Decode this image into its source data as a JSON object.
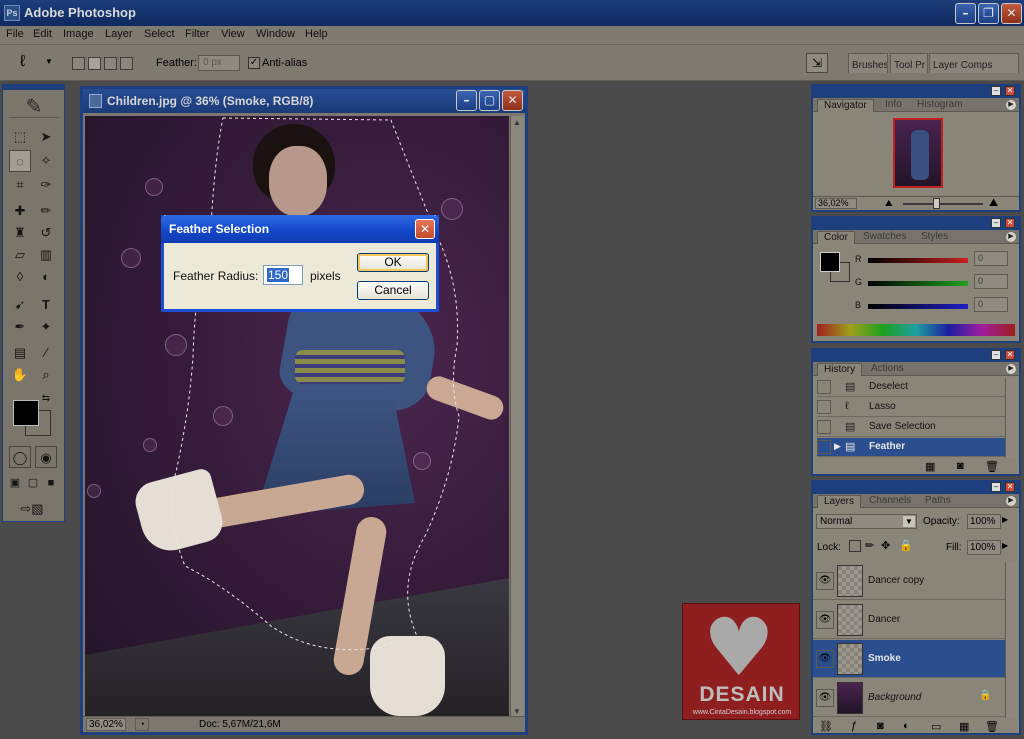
{
  "app": {
    "title": "Adobe Photoshop",
    "icon_text": "Ps"
  },
  "menu": [
    "File",
    "Edit",
    "Image",
    "Layer",
    "Select",
    "Filter",
    "View",
    "Window",
    "Help"
  ],
  "options": {
    "feather_label": "Feather:",
    "feather_value": "0 px",
    "antialias_label": "Anti-alias",
    "antialias_checked": true,
    "well_tabs": [
      "Brushes",
      "Tool Pr",
      "Layer Comps"
    ]
  },
  "document": {
    "title": "Children.jpg @ 36% (Smoke, RGB/8)",
    "zoom": "36,02%",
    "doc_info": "Doc: 5,67M/21,6M"
  },
  "dialog": {
    "title": "Feather Selection",
    "radius_label": "Feather Radius:",
    "radius_value": "150",
    "units": "pixels",
    "ok": "OK",
    "cancel": "Cancel"
  },
  "navigator_panel": {
    "tabs": [
      "Navigator",
      "Info",
      "Histogram"
    ],
    "active_tab": "Navigator",
    "zoom": "36,02%"
  },
  "color_panel": {
    "tabs": [
      "Color",
      "Swatches",
      "Styles"
    ],
    "active_tab": "Color",
    "channels": [
      {
        "label": "R",
        "value": "0",
        "color": "#c81e1e"
      },
      {
        "label": "G",
        "value": "0",
        "color": "#1ea01e"
      },
      {
        "label": "B",
        "value": "0",
        "color": "#1e1ec8"
      }
    ]
  },
  "history_panel": {
    "tabs": [
      "History",
      "Actions"
    ],
    "active_tab": "History",
    "items": [
      {
        "label": "Deselect",
        "icon": "document-icon"
      },
      {
        "label": "Lasso",
        "icon": "lasso-icon"
      },
      {
        "label": "Save Selection",
        "icon": "document-icon"
      },
      {
        "label": "Feather",
        "icon": "document-icon",
        "selected": true
      }
    ]
  },
  "layers_panel": {
    "tabs": [
      "Layers",
      "Channels",
      "Paths"
    ],
    "active_tab": "Layers",
    "blend_mode": "Normal",
    "opacity_label": "Opacity:",
    "opacity_value": "100%",
    "lock_label": "Lock:",
    "fill_label": "Fill:",
    "fill_value": "100%",
    "layers": [
      {
        "name": "Dancer copy",
        "visible": true
      },
      {
        "name": "Dancer",
        "visible": true
      },
      {
        "name": "Smoke",
        "visible": true,
        "selected": true
      },
      {
        "name": "Background",
        "visible": true,
        "locked": true
      }
    ]
  },
  "watermark": {
    "brand": "DESAIN",
    "url": "www.CintaDesain.blogspot.com"
  }
}
